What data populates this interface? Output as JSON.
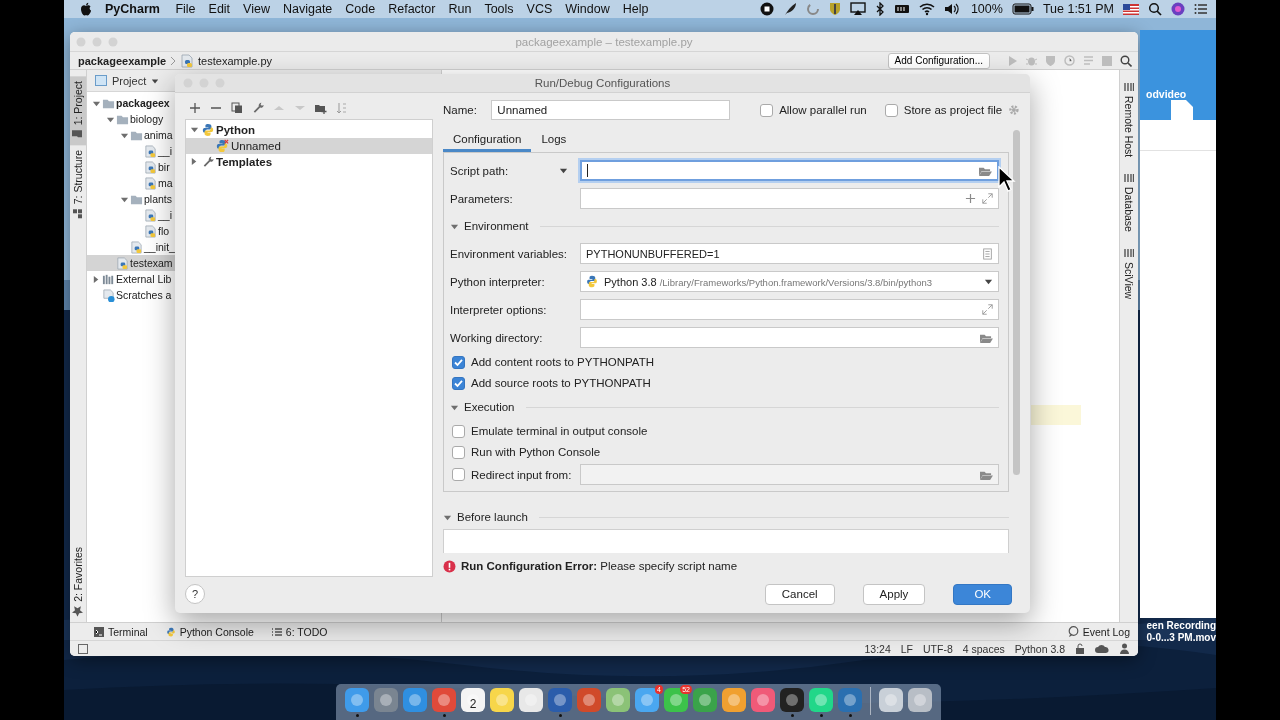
{
  "menu_bar": {
    "app_name": "PyCharm",
    "menus": [
      "File",
      "Edit",
      "View",
      "Navigate",
      "Code",
      "Refactor",
      "Run",
      "Tools",
      "VCS",
      "Window",
      "Help"
    ],
    "battery_percent": "100%",
    "clock": "Tue 1:51 PM"
  },
  "ide": {
    "title": "packageexample – testexample.py",
    "breadcrumb": [
      "packageexample",
      "testexample.py"
    ],
    "add_configuration": "Add Configuration...",
    "left_tabs": [
      {
        "label": "1: Project",
        "selected": true
      },
      {
        "label": "7: Structure",
        "selected": false
      }
    ],
    "favorites_tab": "2: Favorites",
    "project": {
      "title": "Project",
      "tree": [
        {
          "label": "packageex",
          "kind": "project",
          "expanded": true,
          "selected": false,
          "children": [
            {
              "label": "biology",
              "kind": "folder",
              "expanded": true,
              "selected": false,
              "children": [
                {
                  "label": "anima",
                  "kind": "folder",
                  "expanded": true,
                  "selected": false,
                  "children": [
                    {
                      "label": "__i",
                      "kind": "file",
                      "selected": false
                    },
                    {
                      "label": "bir",
                      "kind": "file",
                      "selected": false
                    },
                    {
                      "label": "ma",
                      "kind": "file",
                      "selected": false
                    }
                  ]
                },
                {
                  "label": "plants",
                  "kind": "folder",
                  "expanded": true,
                  "selected": false,
                  "children": [
                    {
                      "label": "__i",
                      "kind": "file",
                      "selected": false
                    },
                    {
                      "label": "flo",
                      "kind": "file",
                      "selected": false
                    }
                  ]
                },
                {
                  "label": "__init_",
                  "kind": "file",
                  "selected": false
                }
              ]
            },
            {
              "label": "testexam",
              "kind": "file",
              "selected": true
            }
          ]
        },
        {
          "label": "External Lib",
          "kind": "library",
          "expanded": false,
          "selected": false
        },
        {
          "label": "Scratches a",
          "kind": "scratch",
          "selected": false
        }
      ]
    },
    "right_tabs": [
      "Remote Host",
      "Database",
      "SciView"
    ],
    "bottom_tabs": [
      {
        "label": "Terminal",
        "kind": "terminal"
      },
      {
        "label": "Python Console",
        "kind": "python"
      },
      {
        "label": "6: TODO",
        "kind": "todo"
      }
    ],
    "event_log": "Event Log",
    "status_bar": [
      "13:24",
      "LF",
      "UTF-8",
      "4 spaces",
      "Python 3.8"
    ]
  },
  "dialog": {
    "title": "Run/Debug Configurations",
    "tree": [
      {
        "label": "Python",
        "expanded": true,
        "selected": false,
        "children": [
          {
            "label": "Unnamed",
            "selected": true
          }
        ]
      },
      {
        "label": "Templates",
        "expanded": false,
        "selected": false
      }
    ],
    "name_label": "Name:",
    "name_value": "Unnamed",
    "options": [
      {
        "label": "Allow parallel run",
        "checked": false
      },
      {
        "label": "Store as project file",
        "checked": false
      }
    ],
    "tabs": [
      {
        "label": "Configuration",
        "selected": true
      },
      {
        "label": "Logs",
        "selected": false
      }
    ],
    "rows": [
      {
        "kind": "path-field",
        "label": "Script path:",
        "dropdown": true,
        "focused": true
      },
      {
        "kind": "parameters-field",
        "label": "Parameters:",
        "dropdown": false,
        "focused": false
      },
      {
        "kind": "section",
        "label": "Environment",
        "expanded": true
      },
      {
        "kind": "env-field",
        "label": "Environment variables:",
        "value": "PYTHONUNBUFFERED=1",
        "dropdown": false,
        "focused": false
      },
      {
        "kind": "interpreter-field",
        "label": "Python interpreter:",
        "value": "Python 3.8",
        "detail": "/Library/Frameworks/Python.framework/Versions/3.8/bin/python3",
        "dropdown": false,
        "focused": false
      },
      {
        "kind": "expand-field",
        "label": "Interpreter options:",
        "dropdown": false,
        "focused": false
      },
      {
        "kind": "path-field",
        "label": "Working directory:",
        "dropdown": false,
        "focused": false
      },
      {
        "kind": "checkbox",
        "label": "Add content roots to PYTHONPATH",
        "checked": true
      },
      {
        "kind": "checkbox",
        "label": "Add source roots to PYTHONPATH",
        "checked": true
      },
      {
        "kind": "section",
        "label": "Execution",
        "expanded": true
      },
      {
        "kind": "checkbox",
        "label": "Emulate terminal in output console",
        "checked": false
      },
      {
        "kind": "checkbox",
        "label": "Run with Python Console",
        "checked": false
      },
      {
        "kind": "checkbox-field",
        "label": "Redirect input from:",
        "checked": false,
        "disabled": true
      }
    ],
    "before_launch": {
      "label": "Before launch",
      "expanded": true
    },
    "error": "**Run Configuration Error:** Please specify script name",
    "help": "?",
    "buttons": [
      {
        "label": "Cancel",
        "default": false
      },
      {
        "label": "Apply",
        "default": false
      },
      {
        "label": "OK",
        "default": true
      }
    ]
  },
  "desktop": {
    "folder_label": "odvideo",
    "file_label": [
      "een Recording",
      "0-0...3 PM.mov"
    ]
  },
  "dock": [
    {
      "kind": "app",
      "color": "#3f9bea",
      "running": true
    },
    {
      "kind": "app",
      "color": "#7a8591",
      "running": false
    },
    {
      "kind": "app",
      "color": "#2f8fe0",
      "running": false
    },
    {
      "kind": "app",
      "color": "#e04a3a",
      "running": true
    },
    {
      "kind": "app",
      "color": "#f4f4f4",
      "running": false,
      "label": "2"
    },
    {
      "kind": "app",
      "color": "#f7d64a",
      "running": false
    },
    {
      "kind": "app",
      "color": "#e8e8e8",
      "running": false
    },
    {
      "kind": "app",
      "color": "#2b5dab",
      "running": true
    },
    {
      "kind": "app",
      "color": "#d04a2a",
      "running": false
    },
    {
      "kind": "app",
      "color": "#8bc277",
      "running": false
    },
    {
      "kind": "app",
      "color": "#4aa7f0",
      "running": false,
      "badge": "4"
    },
    {
      "kind": "app",
      "color": "#3cc24a",
      "running": false,
      "badge": "52"
    },
    {
      "kind": "app",
      "color": "#3aa34a",
      "running": false
    },
    {
      "kind": "app",
      "color": "#f0a030",
      "running": false
    },
    {
      "kind": "app",
      "color": "#f05a78",
      "running": false
    },
    {
      "kind": "app",
      "color": "#222222",
      "running": true
    },
    {
      "kind": "app",
      "color": "#21d789",
      "running": true
    },
    {
      "kind": "app",
      "color": "#2a6fb0",
      "running": true
    },
    {
      "kind": "separator"
    },
    {
      "kind": "app",
      "color": "#c9d0d8",
      "running": false
    },
    {
      "kind": "app",
      "color": "#b8bec6",
      "running": false
    }
  ]
}
